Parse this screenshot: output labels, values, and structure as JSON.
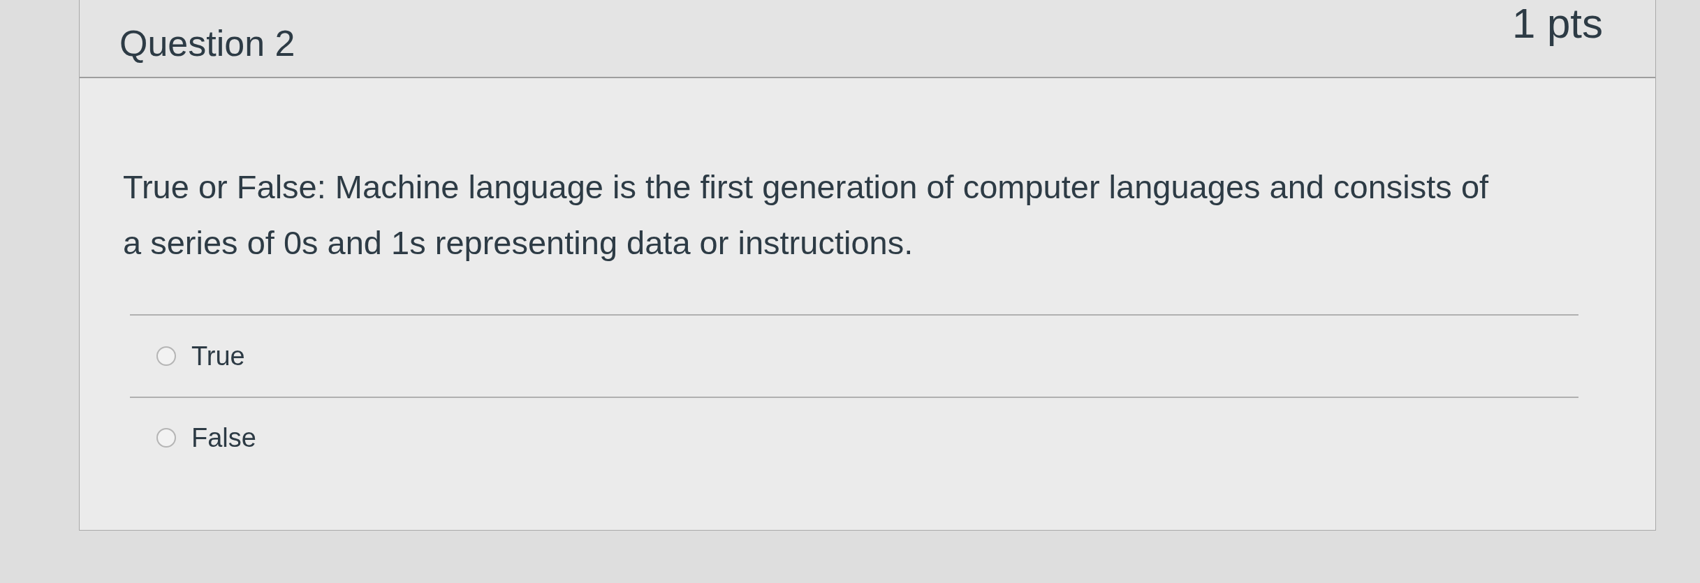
{
  "question": {
    "title": "Question 2",
    "points": "1 pts",
    "text": "True or False: Machine language is the first generation of computer languages and consists of a series of 0s and 1s representing data or instructions."
  },
  "answers": [
    {
      "label": "True",
      "selected": false
    },
    {
      "label": "False",
      "selected": false
    }
  ]
}
